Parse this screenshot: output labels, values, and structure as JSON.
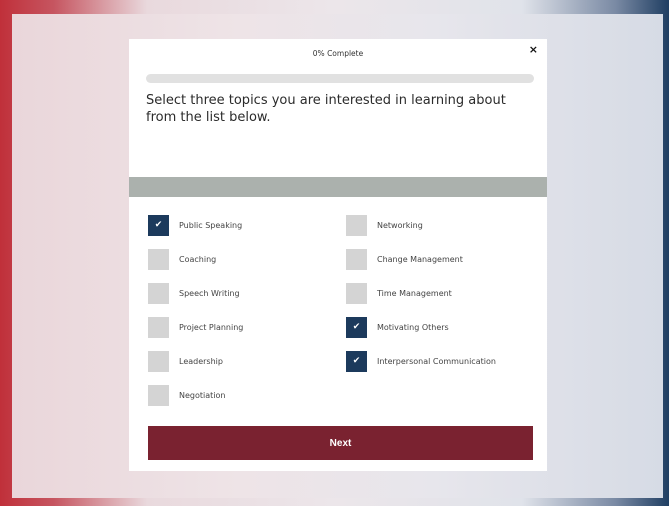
{
  "progress": {
    "label": "0% Complete",
    "percent": 0
  },
  "question": {
    "text": "Select three topics you are interested in learning about from the list below."
  },
  "close_label": "×",
  "check_glyph": "✔",
  "options": [
    {
      "label": "Public Speaking",
      "checked": true
    },
    {
      "label": "Coaching",
      "checked": false
    },
    {
      "label": "Speech Writing",
      "checked": false
    },
    {
      "label": "Project Planning",
      "checked": false
    },
    {
      "label": "Leadership",
      "checked": false
    },
    {
      "label": "Negotiation",
      "checked": false
    },
    {
      "label": "Networking",
      "checked": false
    },
    {
      "label": "Change Management",
      "checked": false
    },
    {
      "label": "Time Management",
      "checked": false
    },
    {
      "label": "Motivating Others",
      "checked": true
    },
    {
      "label": "Interpersonal Communication",
      "checked": true
    }
  ],
  "next_button": {
    "label": "Next"
  },
  "colors": {
    "accent": "#7a2230",
    "checked": "#1c3a5c",
    "unchecked": "#d4d4d4",
    "band": "#abb1ad"
  }
}
